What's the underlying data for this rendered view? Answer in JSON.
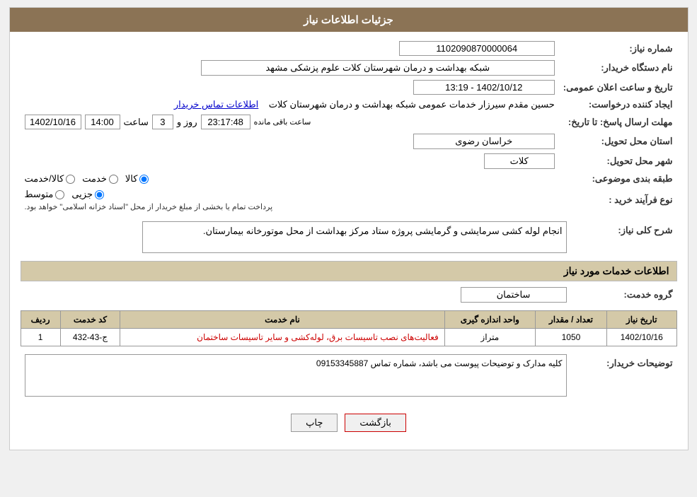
{
  "header": {
    "title": "جزئیات اطلاعات نیاز"
  },
  "fields": {
    "need_number_label": "شماره نیاز:",
    "need_number_value": "1102090870000064",
    "buyer_org_label": "نام دستگاه خریدار:",
    "buyer_org_value": "شبکه بهداشت و درمان شهرستان کلات   علوم پزشکی مشهد",
    "creator_label": "ایجاد کننده درخواست:",
    "creator_name": "حسین مقدم سیرزار خدمات عمومی شبکه بهداشت و درمان شهرستان کلات",
    "creator_link": "اطلاعات تماس خریدار",
    "announce_datetime_label": "تاریخ و ساعت اعلان عمومی:",
    "announce_datetime_value": "1402/10/12 - 13:19",
    "send_deadline_label": "مهلت ارسال پاسخ: تا تاریخ:",
    "send_deadline_date": "1402/10/16",
    "send_deadline_time": "14:00",
    "send_deadline_days": "3",
    "send_deadline_remaining": "23:17:48",
    "province_label": "استان محل تحویل:",
    "province_value": "خراسان رضوی",
    "city_label": "شهر محل تحویل:",
    "city_value": "کلات",
    "category_label": "طبقه بندی موضوعی:",
    "category_kala": "کالا",
    "category_khedmat": "خدمت",
    "category_kala_khedmat": "کالا/خدمت",
    "purchase_type_label": "نوع فرآیند خرید :",
    "purchase_type_jozee": "جزیی",
    "purchase_type_motavsat": "متوسط",
    "purchase_type_note": "پرداخت تمام یا بخشی از مبلغ خریدار از محل \"اسناد خزانه اسلامی\" خواهد بود.",
    "description_label": "شرح کلی نیاز:",
    "description_value": "انجام لوله کشی سرمایشی و گرمایشی پروژه ستاد مرکز بهداشت از محل موتورخانه بیمارستان.",
    "services_section_label": "اطلاعات خدمات مورد نیاز",
    "service_group_label": "گروه خدمت:",
    "service_group_value": "ساختمان",
    "table_headers": {
      "row_num": "ردیف",
      "service_code": "کد خدمت",
      "service_name": "نام خدمت",
      "unit": "واحد اندازه گیری",
      "quantity": "تعداد / مقدار",
      "need_date": "تاریخ نیاز"
    },
    "table_rows": [
      {
        "row_num": "1",
        "service_code": "ج-43-432",
        "service_name": "فعالیت‌های نصب تاسیسات برق، لوله‌کشی و سایر تاسیسات ساختمان",
        "unit": "متراز",
        "quantity": "1050",
        "need_date": "1402/10/16"
      }
    ],
    "buyer_notes_label": "توضیحات خریدار:",
    "buyer_notes_value": "کلیه مدارک و توضیحات پیوست می باشد، شماره تماس 09153345887",
    "btn_print": "چاپ",
    "btn_back": "بازگشت"
  }
}
